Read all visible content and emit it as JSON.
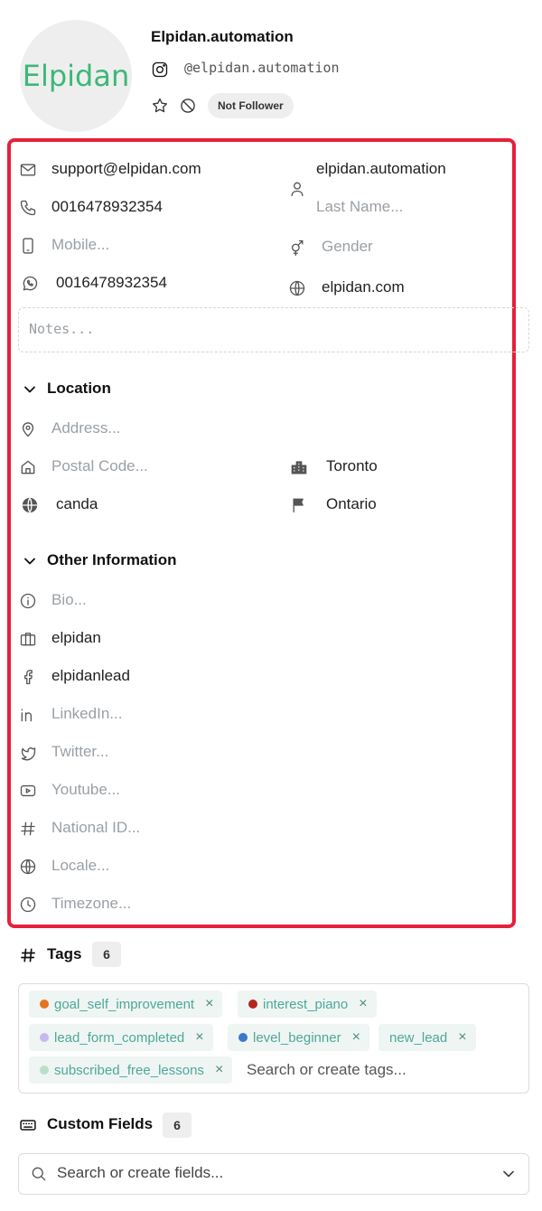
{
  "profile": {
    "avatar_text": "Elpidan",
    "name": "Elpidan.automation",
    "handle": "@elpidan.automation",
    "follower_status": "Not Follower"
  },
  "contact": {
    "email": "support@elpidan.com",
    "phone": "0016478932354",
    "mobile_placeholder": "Mobile...",
    "whatsapp": "0016478932354",
    "first_name": "elpidan.automation",
    "last_name_placeholder": "Last Name...",
    "gender_placeholder": "Gender",
    "website": "elpidan.com",
    "notes_placeholder": "Notes..."
  },
  "location": {
    "title": "Location",
    "address_placeholder": "Address...",
    "postal_code_placeholder": "Postal Code...",
    "city": "Toronto",
    "country": "canda",
    "state": "Ontario"
  },
  "other_info": {
    "title": "Other Information",
    "bio_placeholder": "Bio...",
    "company": "elpidan",
    "facebook": "elpidanlead",
    "linkedin_placeholder": "LinkedIn...",
    "twitter_placeholder": "Twitter...",
    "youtube_placeholder": "Youtube...",
    "national_id_placeholder": "National ID...",
    "locale_placeholder": "Locale...",
    "timezone_placeholder": "Timezone..."
  },
  "tags": {
    "title": "Tags",
    "count": "6",
    "items": [
      {
        "label": "goal_self_improvement",
        "color": "#e8731e"
      },
      {
        "label": "interest_piano",
        "color": "#b3261e"
      },
      {
        "label": "lead_form_completed",
        "color": "#c9b8f0"
      },
      {
        "label": "level_beginner",
        "color": "#3b78c9"
      },
      {
        "label": "new_lead",
        "color": ""
      },
      {
        "label": "subscribed_free_lessons",
        "color": "#b8e0c8"
      }
    ],
    "remove_glyph": "×",
    "search_placeholder": "Search or create tags..."
  },
  "custom_fields": {
    "title": "Custom Fields",
    "count": "6",
    "search_placeholder": "Search or create fields..."
  },
  "colors": {
    "highlight_border": "#e6203a",
    "logo_green": "#3cb878",
    "chip_text": "#4ea89a",
    "chip_bg": "#eef5f3"
  }
}
